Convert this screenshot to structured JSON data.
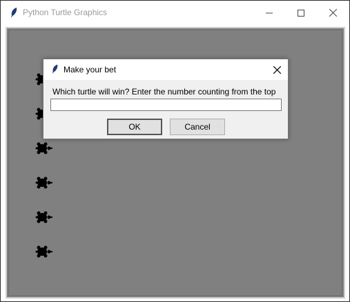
{
  "window": {
    "title": "Python Turtle Graphics",
    "controls": {
      "minimize": "minimize-icon",
      "maximize": "maximize-icon",
      "close": "close-icon"
    }
  },
  "canvas": {
    "background": "#808080",
    "turtles": [
      "turtle-1",
      "turtle-2",
      "turtle-3",
      "turtle-4",
      "turtle-5",
      "turtle-6"
    ],
    "turtle_color": "#000000"
  },
  "dialog": {
    "title": "Make your bet",
    "prompt": "Which turtle will win? Enter the number counting from the top",
    "input_value": "",
    "ok_label": "OK",
    "cancel_label": "Cancel"
  }
}
